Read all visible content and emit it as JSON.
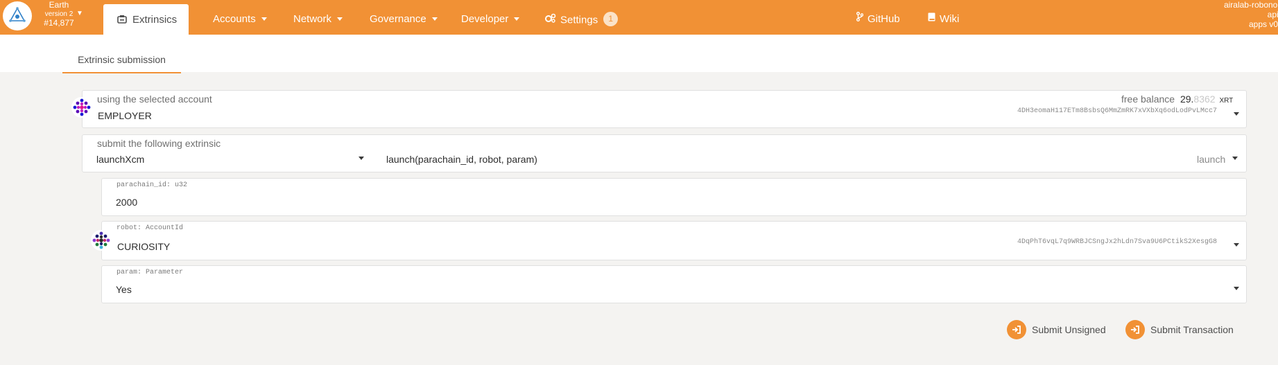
{
  "chain": {
    "name": "Earth",
    "version": "version 2",
    "block": "#14,877"
  },
  "nav": {
    "active": "Extrinsics",
    "items": [
      "Accounts",
      "Network",
      "Governance",
      "Developer"
    ],
    "settings": {
      "label": "Settings",
      "badge": "1"
    },
    "github": "GitHub",
    "wiki": "Wiki"
  },
  "api_info": {
    "node": "airalab-robonomics",
    "api": "api v",
    "apps": "apps v0"
  },
  "subnav": {
    "tab": "Extrinsic submission"
  },
  "account": {
    "label": "using the selected account",
    "name": "EMPLOYER",
    "free_balance_label": "free balance",
    "balance_int": "29.",
    "balance_dec": "8362",
    "unit": "XRT",
    "address": "4DH3eomaH117ETm8BsbsQ6MmZmRK7xVXbXq6odLodPvLMcc7"
  },
  "extrinsic": {
    "label": "submit the following extrinsic",
    "call": "launchXcm",
    "signature": "launch(parachain_id, robot, param)",
    "section": "launch"
  },
  "params": {
    "parachain_id": {
      "label": "parachain_id: u32",
      "value": "2000"
    },
    "robot": {
      "label": "robot: AccountId",
      "name": "CURIOSITY",
      "address": "4DqPhT6vqL7q9WRBJCSngJx2hLdn7Sva9U6PCtikS2XesgG8"
    },
    "param": {
      "label": "param: Parameter",
      "value": "Yes"
    }
  },
  "actions": {
    "unsigned": "Submit Unsigned",
    "transaction": "Submit Transaction"
  },
  "colors": {
    "accent": "#f19135",
    "background": "#f4f3f1"
  }
}
